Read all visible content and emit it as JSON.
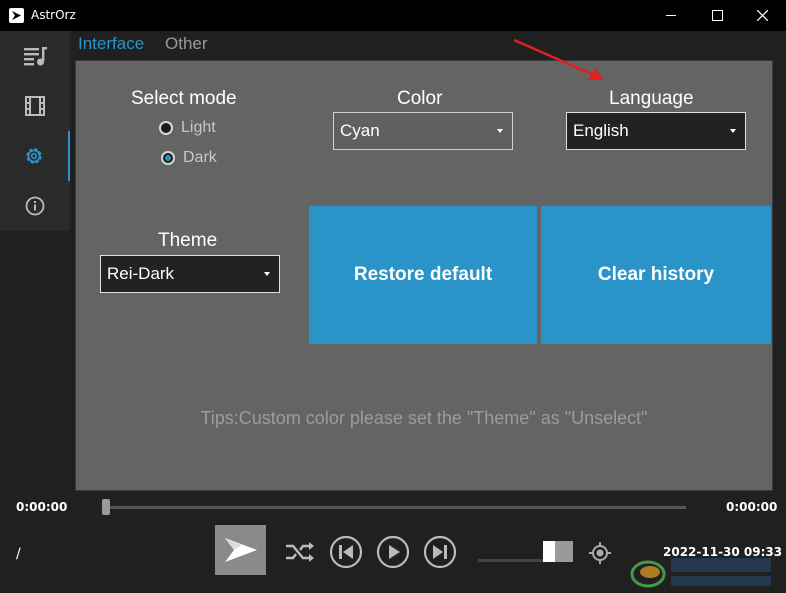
{
  "window": {
    "title": "AstrOrz"
  },
  "tabs": [
    {
      "label": "Interface",
      "active": true
    },
    {
      "label": "Other",
      "active": false
    }
  ],
  "sidebar": {
    "items": [
      {
        "icon": "playlist-icon"
      },
      {
        "icon": "film-icon"
      },
      {
        "icon": "gear-icon",
        "active": true
      },
      {
        "icon": "info-icon"
      }
    ]
  },
  "settings": {
    "mode": {
      "label": "Select mode",
      "options": [
        "Light",
        "Dark"
      ],
      "selected": "Dark"
    },
    "color": {
      "label": "Color",
      "value": "Cyan"
    },
    "language": {
      "label": "Language",
      "value": "English"
    },
    "theme": {
      "label": "Theme",
      "value": "Rei-Dark"
    },
    "restore_label": "Restore default",
    "clear_label": "Clear history",
    "tips": "Tips:Custom color please set the \"Theme\" as \"Unselect\""
  },
  "player": {
    "time_current": "0:00:00",
    "time_total": "0:00:00",
    "playlist_status": "/",
    "datetime": "2022-11-30 09:33"
  },
  "colors": {
    "accent": "#2a94c8",
    "panel": "#646464",
    "annotation_arrow": "#e02020"
  }
}
